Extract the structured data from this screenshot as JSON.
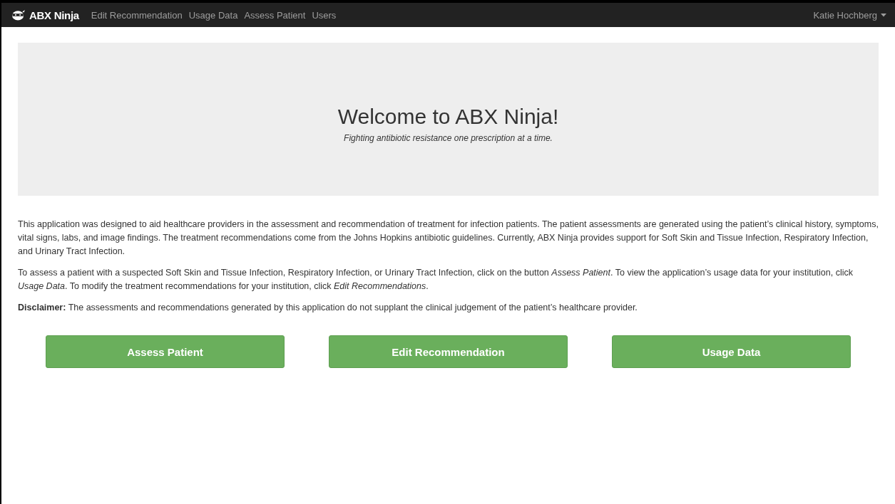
{
  "navbar": {
    "brand": "ABX Ninja",
    "links": [
      {
        "label": "Edit Recommendation",
        "selected": false
      },
      {
        "label": "Usage Data",
        "selected": false
      },
      {
        "label": "Assess Patient",
        "selected": false
      },
      {
        "label": "Users",
        "selected": false
      }
    ],
    "user": "Katie Hochberg"
  },
  "hero": {
    "title": "Welcome to ABX Ninja!",
    "tagline": "Fighting antibiotic resistance one prescription at a time."
  },
  "paragraphs": [
    "This application was designed to aid healthcare providers in the assessment and recommendation of treatment for infection patients.  The patient assessments are generated using the patient’s clinical history, symptoms, vital signs, labs, and image findings.  The treatment recommendations come from the Johns Hopkins antibiotic guidelines.  Currently, ABX Ninja provides support for Soft Skin and Tissue Infection, Respiratory Infection, and Urinary Tract Infection.",
    "To assess a patient with a suspected Soft Skin and Tissue Infection, Respiratory Infection, or Urinary Tract Infection, click on the button *Assess Patient*. To view the application’s usage data for your institution, click *Usage Data*. To modify the treatment recommendations for your institution, click *Edit Recommendations*.",
    "**Disclaimer:** The assessments and recommendations generated by this application do not supplant the clinical judgement of the patient’s healthcare provider."
  ],
  "buttons": [
    "Assess Patient",
    "Edit Recommendation",
    "Usage Data"
  ]
}
